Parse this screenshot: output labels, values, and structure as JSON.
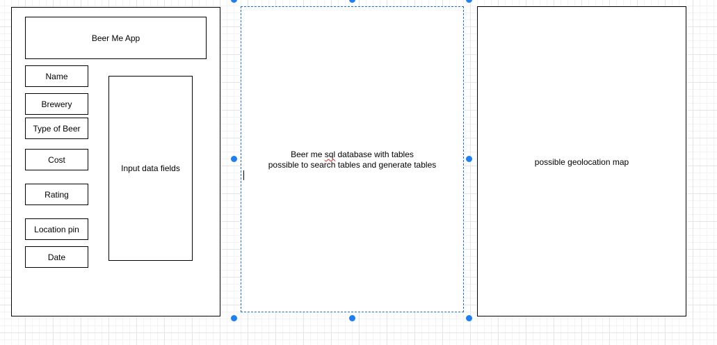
{
  "app_panel": {
    "title": "Beer Me App",
    "fields": [
      "Name",
      "Brewery",
      "Type of Beer",
      "Cost",
      "Rating",
      "Location pin",
      "Date"
    ],
    "input_box_label": "Input data fields"
  },
  "database_panel": {
    "line1_prefix": "Beer me ",
    "line1_underlined": "sql",
    "line1_suffix": " database with tables",
    "line2": "possible to search tables and generate tables"
  },
  "map_panel": {
    "label": "possible geolocation map"
  },
  "colors": {
    "selection_handle": "#1d7ff0",
    "selection_border": "#1a6fc2",
    "spellcheck_underline": "#e02020"
  }
}
